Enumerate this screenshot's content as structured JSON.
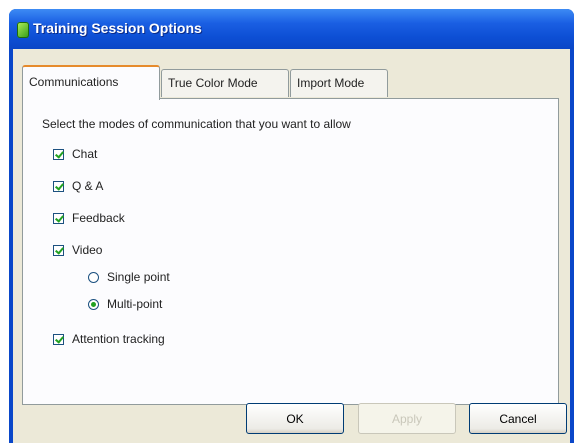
{
  "window": {
    "title": "Training Session Options"
  },
  "tabs": [
    {
      "label": "Communications",
      "active": true
    },
    {
      "label": "True Color Mode",
      "active": false
    },
    {
      "label": "Import Mode",
      "active": false
    }
  ],
  "communications": {
    "instruction": "Select the modes of communication that you want to allow",
    "options": [
      {
        "label": "Chat",
        "checked": true
      },
      {
        "label": "Q & A",
        "checked": true
      },
      {
        "label": "Feedback",
        "checked": true
      },
      {
        "label": "Video",
        "checked": true
      }
    ],
    "video_modes": [
      {
        "label": "Single point",
        "selected": false
      },
      {
        "label": "Multi-point",
        "selected": true
      }
    ],
    "attention": {
      "label": "Attention tracking",
      "checked": true
    }
  },
  "buttons": {
    "ok": "OK",
    "apply": "Apply",
    "cancel": "Cancel"
  }
}
